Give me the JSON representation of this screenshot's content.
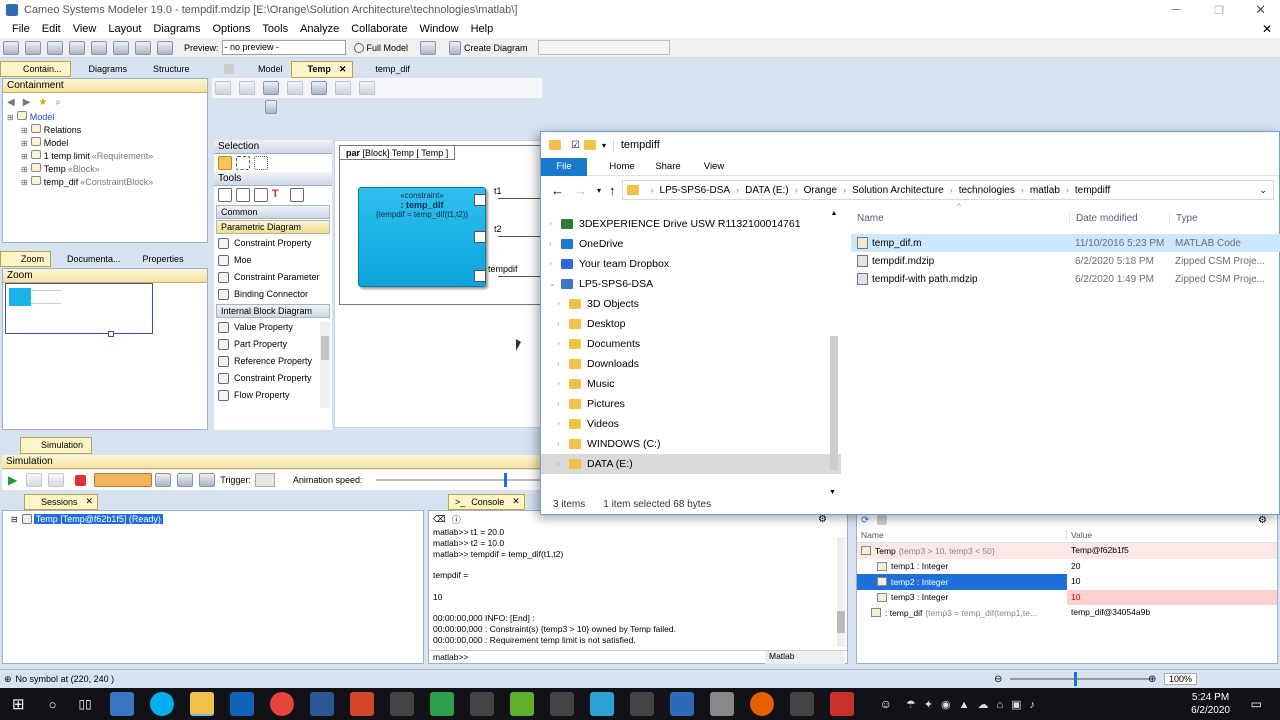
{
  "window": {
    "title": "Cameo Systems Modeler 19.0 - tempdif.mdzip [E:\\Orange\\Solution Architecture\\technologies\\matlab\\]"
  },
  "menu": [
    "File",
    "Edit",
    "View",
    "Layout",
    "Diagrams",
    "Options",
    "Tools",
    "Analyze",
    "Collaborate",
    "Window",
    "Help"
  ],
  "toolbar": {
    "preview_label": "Preview:",
    "preview_value": "- no preview -",
    "full_model": "Full Model",
    "create_diagram": "Create Diagram"
  },
  "left_tabs": [
    "Contain...",
    "Diagrams",
    "Structure"
  ],
  "containment": {
    "title": "Containment",
    "items": [
      {
        "label": "Model",
        "stereo": ""
      },
      {
        "label": "Relations",
        "stereo": ""
      },
      {
        "label": "Model",
        "stereo": ""
      },
      {
        "label": "1 temp limit",
        "stereo": "«Requirement»"
      },
      {
        "label": "Temp",
        "stereo": "«Block»"
      },
      {
        "label": "temp_dif",
        "stereo": "«ConstraintBlock»"
      }
    ]
  },
  "zoom_tabs": [
    "Zoom",
    "Documenta...",
    "Properties"
  ],
  "zoom_title": "Zoom",
  "editor_tabs": [
    "Model",
    "Temp",
    "temp_dif"
  ],
  "palette": {
    "selection": "Selection",
    "tools": "Tools",
    "sections": {
      "common": "Common",
      "parametric": "Parametric Diagram",
      "ibd": "Internal Block Diagram"
    },
    "parametric_items": [
      "Constraint Property",
      "Moe",
      "Constraint Parameter",
      "Binding Connector"
    ],
    "ibd_items": [
      "Value Property",
      "Part Property",
      "Reference Property",
      "Constraint Property",
      "Flow Property"
    ]
  },
  "diagram": {
    "frame_label_kw": "par",
    "frame_label": "[Block] Temp [ Temp ]",
    "constraint_stereo": "«constraint»",
    "constraint_name": ": temp_dif",
    "constraint_expr": "{tempdif = temp_dif(t1,t2)}",
    "ports": [
      "t1",
      "t2",
      "tempdif"
    ]
  },
  "simulation": {
    "tab": "Simulation",
    "title": "Simulation",
    "trigger": "Trigger:",
    "anim_speed": "Animation speed:",
    "sessions_tab": "Sessions",
    "session_item": "Temp [Temp@f62b1f5] (Ready)",
    "console_tab": "Console",
    "console_lines": [
      "matlab>> t1 = 20.0",
      "matlab>> t2 = 10.0",
      "matlab>> tempdif = temp_dif(t1,t2)",
      "",
      "tempdif =",
      "",
      "10",
      "",
      "00:00:00,000 INFO: [End] :",
      "00:00:00,000 : Constraint(s) {temp3 > 10} owned by Temp failed.",
      "00:00:00,000 : Requirement temp limit is not satisfied."
    ],
    "prompt": "matlab>>",
    "engine": "Matlab",
    "vars_headers": [
      "Name",
      "Value"
    ],
    "vars": [
      {
        "name": "Temp",
        "cond": "{temp3 > 10, temp3 < 50}",
        "value": "Temp@f62b1f5"
      },
      {
        "name": "temp1 : Integer",
        "cond": "",
        "value": "20"
      },
      {
        "name": "temp2 : Integer",
        "cond": "",
        "value": "10"
      },
      {
        "name": "temp3 : Integer",
        "cond": "",
        "value": "10"
      },
      {
        "name": ": temp_dif",
        "cond": "{temp3 = temp_dif(temp1,te...",
        "value": "temp_dif@34054a9b"
      }
    ]
  },
  "status": {
    "text": "No symbol at (220, 240 )",
    "zoom": "100%"
  },
  "explorer": {
    "title": "tempdiff",
    "ribbon": [
      "File",
      "Home",
      "Share",
      "View"
    ],
    "path": [
      "LP5-SPS6-DSA",
      "DATA (E:)",
      "Orange",
      "Solution Architecture",
      "technologies",
      "matlab",
      "tempdiff"
    ],
    "nav": [
      {
        "label": "3DEXPERIENCE Drive USW R1132100014761",
        "indent": 0
      },
      {
        "label": "OneDrive",
        "indent": 0
      },
      {
        "label": "Your team Dropbox",
        "indent": 0
      },
      {
        "label": "LP5-SPS6-DSA",
        "indent": 0
      },
      {
        "label": "3D Objects",
        "indent": 1
      },
      {
        "label": "Desktop",
        "indent": 1
      },
      {
        "label": "Documents",
        "indent": 1
      },
      {
        "label": "Downloads",
        "indent": 1
      },
      {
        "label": "Music",
        "indent": 1
      },
      {
        "label": "Pictures",
        "indent": 1
      },
      {
        "label": "Videos",
        "indent": 1
      },
      {
        "label": "WINDOWS (C:)",
        "indent": 1
      },
      {
        "label": "DATA (E:)",
        "indent": 1
      }
    ],
    "columns": [
      "Name",
      "Date modified",
      "Type"
    ],
    "files": [
      {
        "name": "temp_dif.m",
        "date": "11/10/2016 5:23 PM",
        "type": "MATLAB Code"
      },
      {
        "name": "tempdif.mdzip",
        "date": "6/2/2020 5:18 PM",
        "type": "Zipped CSM Proje..."
      },
      {
        "name": "tempdif-with path.mdzip",
        "date": "6/2/2020 1:49 PM",
        "type": "Zipped CSM Proje..."
      }
    ],
    "status_items": "3 items",
    "status_sel": "1 item selected  68 bytes"
  },
  "taskbar": {
    "time": "5:24 PM",
    "date": "6/2/2020"
  }
}
